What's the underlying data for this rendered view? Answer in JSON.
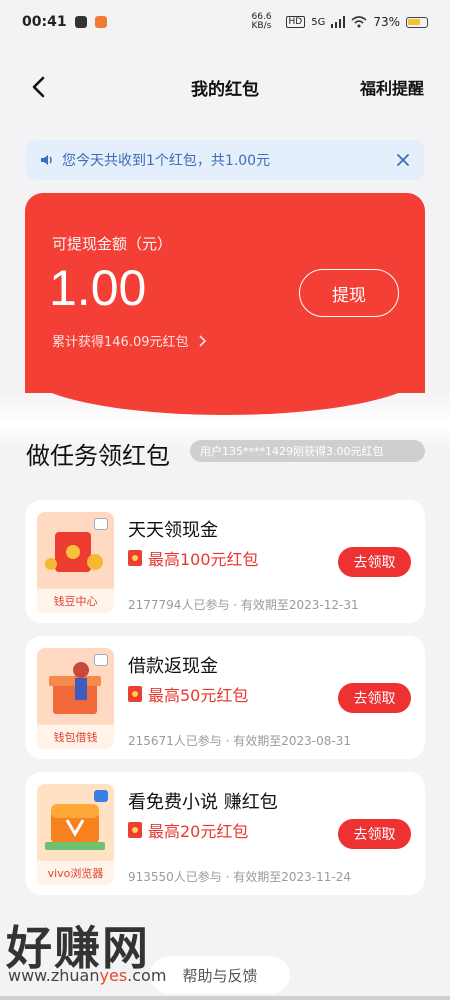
{
  "status_bar": {
    "time": "00:41",
    "net_speed": "66.6 KB/s",
    "hd": "HD",
    "network": "5G",
    "battery": "73%"
  },
  "nav": {
    "title": "我的红包",
    "right_label": "福利提醒"
  },
  "notice": {
    "text": "您今天共收到1个红包，共1.00元"
  },
  "balance_card": {
    "label": "可提现金额（元）",
    "amount": "1.00",
    "cumulative": "累计获得146.09元红包",
    "withdraw_label": "提现"
  },
  "tasks_section": {
    "title": "做任务领红包",
    "ticker": "用户135****1429刚获得3.00元红包"
  },
  "tasks": [
    {
      "title": "天天领现金",
      "reward": "最高100元红包",
      "meta": "2177794人已参与 · 有效期至2023-12-31",
      "source": "钱豆中心",
      "button": "去领取"
    },
    {
      "title": "借款返现金",
      "reward": "最高50元红包",
      "meta": "215671人已参与 · 有效期至2023-08-31",
      "source": "钱包借钱",
      "button": "去领取"
    },
    {
      "title": "看免费小说 赚红包",
      "reward": "最高20元红包",
      "meta": "913550人已参与 · 有效期至2023-11-24",
      "source": "vivo浏览器",
      "button": "去领取"
    }
  ],
  "footer": {
    "feedback": "帮助与反馈",
    "watermark": "好赚网",
    "watermark_url_a": "www.zhuan",
    "watermark_url_b": "yes",
    "watermark_url_c": ".com"
  },
  "colors": {
    "accent_red": "#f33f36",
    "button_red": "#ee3131",
    "notice_bg": "#e5eefb",
    "notice_text": "#3b6db8"
  }
}
